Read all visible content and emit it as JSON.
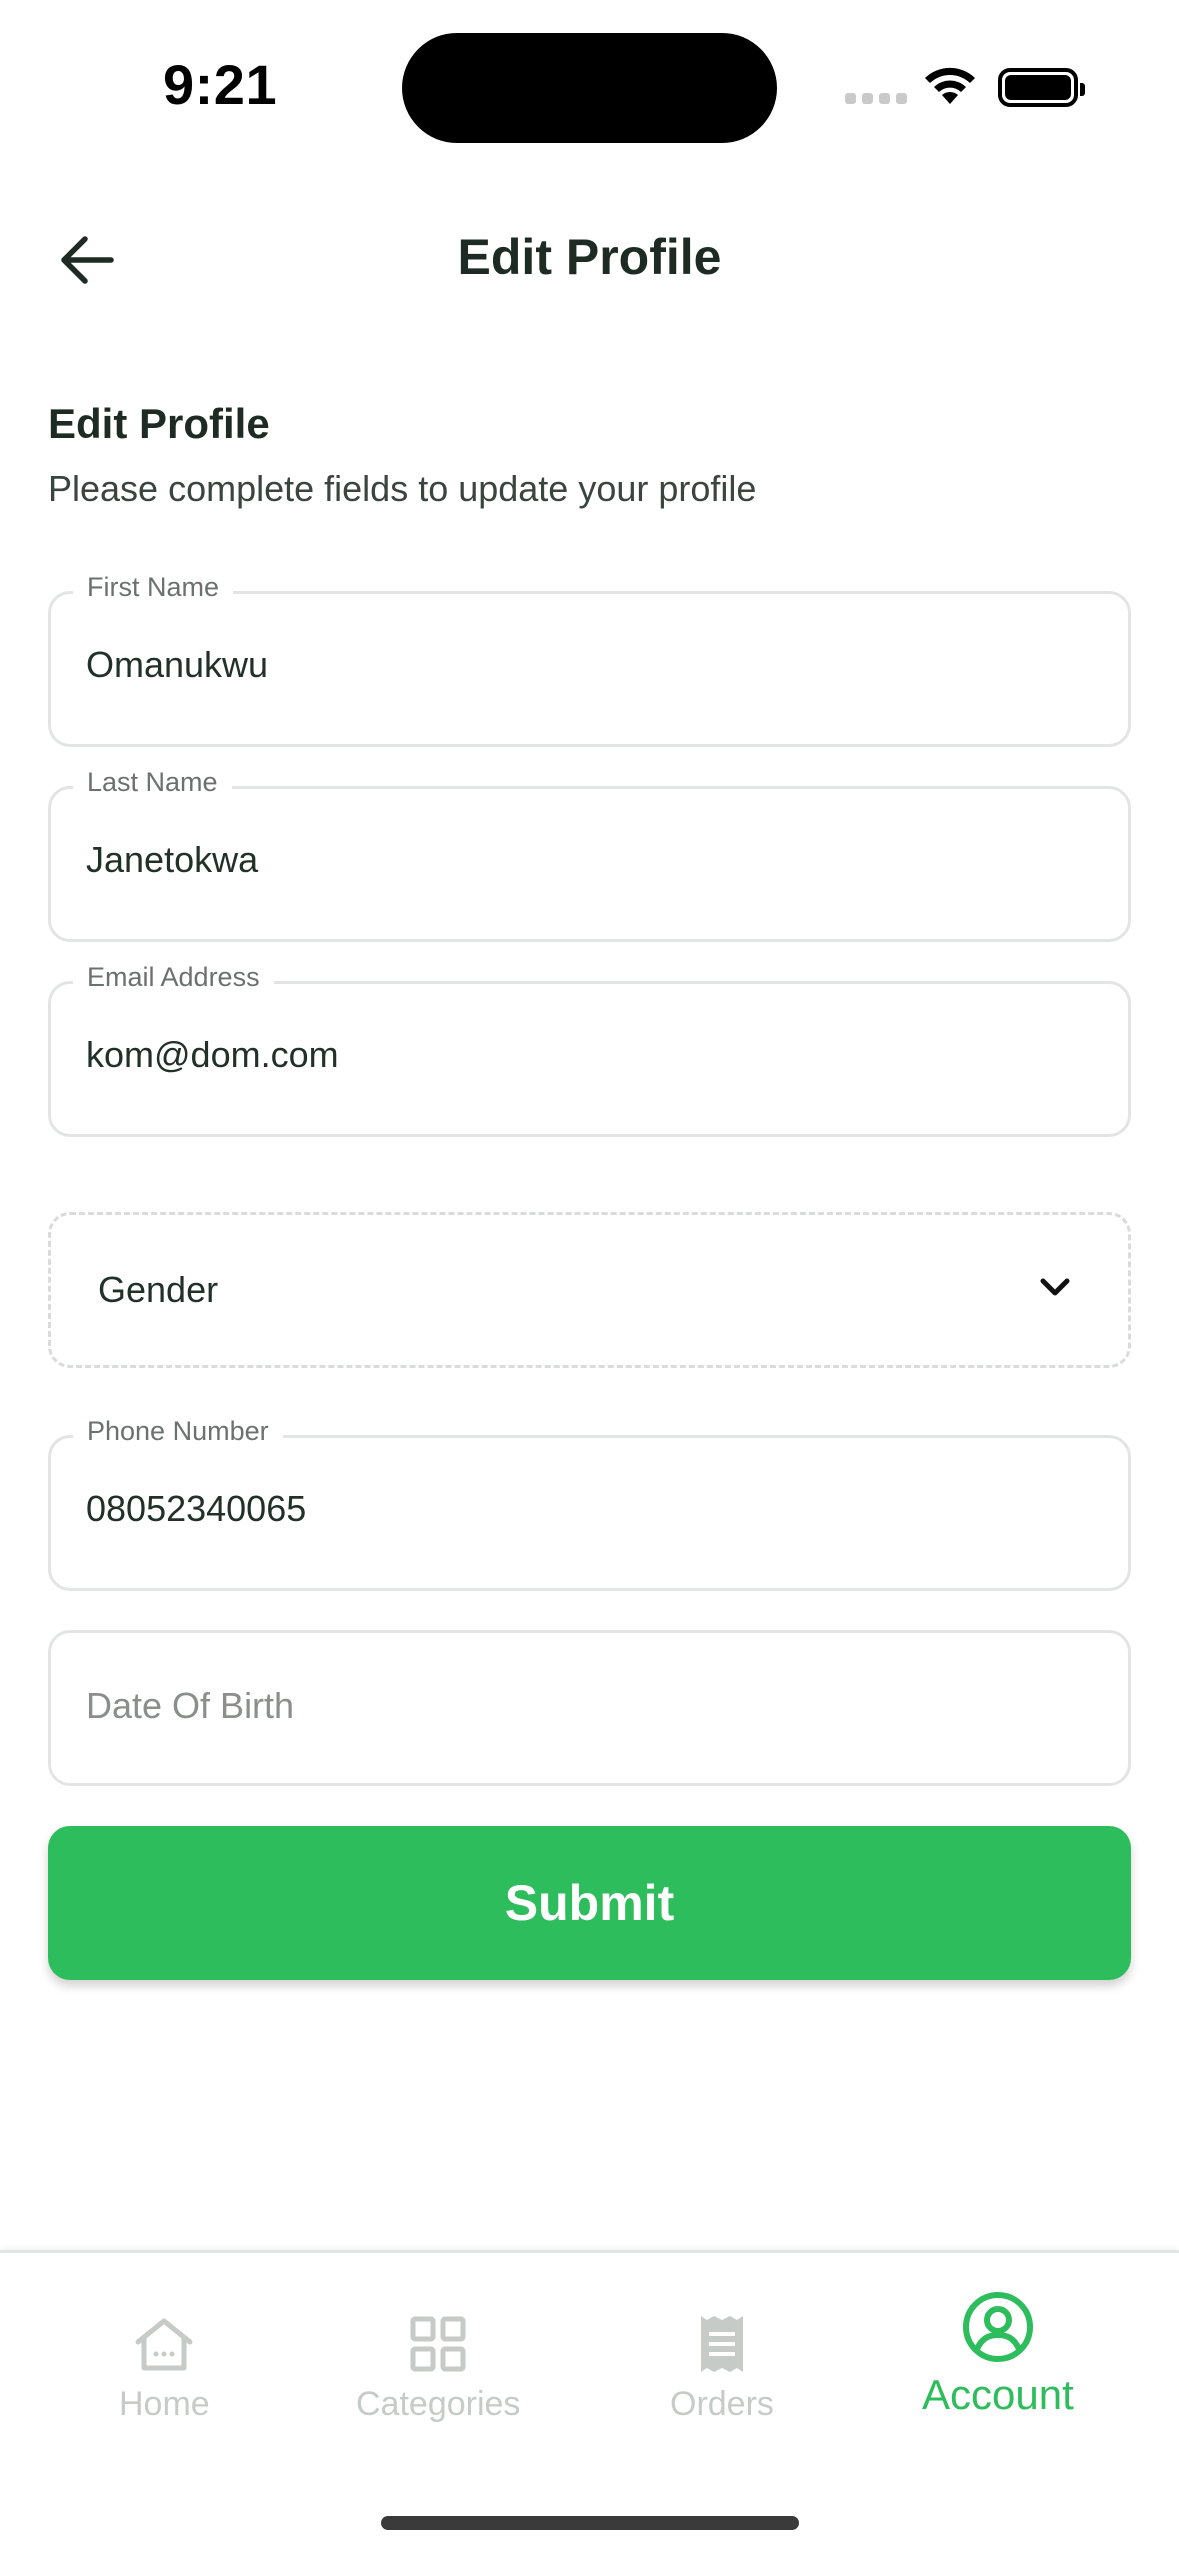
{
  "status_bar": {
    "time": "9:21"
  },
  "header": {
    "title": "Edit Profile",
    "back_icon": "arrow-left-icon"
  },
  "intro": {
    "title": "Edit Profile",
    "subtitle": "Please complete fields to update your profile"
  },
  "form": {
    "first_name": {
      "label": "First Name",
      "value": "Omanukwu"
    },
    "last_name": {
      "label": "Last Name",
      "value": "Janetokwa"
    },
    "email": {
      "label": "Email Address",
      "value": "kom@dom.com"
    },
    "gender": {
      "value": "Gender"
    },
    "phone": {
      "label": "Phone Number",
      "value": "08052340065"
    },
    "dob": {
      "placeholder": "Date Of Birth"
    }
  },
  "submit_label": "Submit",
  "tabs": [
    {
      "label": "Home",
      "icon": "home-icon",
      "active": false
    },
    {
      "label": "Categories",
      "icon": "grid-icon",
      "active": false
    },
    {
      "label": "Orders",
      "icon": "receipt-icon",
      "active": false
    },
    {
      "label": "Account",
      "icon": "user-circle-icon",
      "active": true
    }
  ],
  "colors": {
    "accent": "#2ebd5c",
    "inactive": "#c6cbc8",
    "text": "#1e2b25"
  }
}
